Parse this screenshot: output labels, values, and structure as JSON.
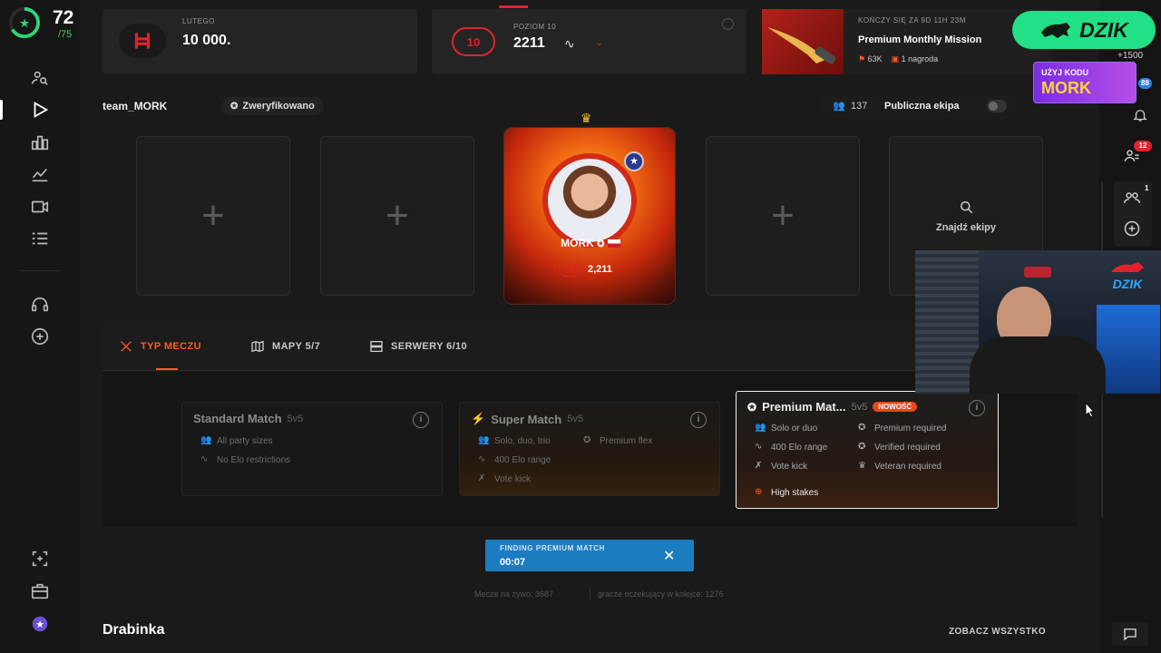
{
  "sidebar": {
    "level": "72",
    "level_sub": "/75"
  },
  "top_cards": {
    "points": {
      "label": "LUTEGO",
      "value": "10 000."
    },
    "level": {
      "label": "POZIOM 10",
      "badge": "10",
      "elo": "2211"
    },
    "mission": {
      "timer": "KOŃCZY SIĘ ZA 9D 11H 23M",
      "title": "Premium Monthly Mission",
      "stat1": "63K",
      "stat2": "1 nagroda"
    }
  },
  "sponsor": {
    "brand": "DZIK",
    "code_label": "UŻYJ KODU",
    "code": "MORK",
    "plus_text": "+1500"
  },
  "team": {
    "name": "team_MORK",
    "verified": "Zweryfikowano",
    "members": "137",
    "public_label": "Publiczna ekipa"
  },
  "player": {
    "name": "MORK",
    "level": "10",
    "elo": "2,211"
  },
  "find_team": {
    "label": "Znajdź ekipy"
  },
  "tabs": [
    {
      "label": "TYP MECZU"
    },
    {
      "label": "MAPY 5/7"
    },
    {
      "label": "SERWERY 6/10"
    }
  ],
  "matches": {
    "standard": {
      "title": "Standard Match",
      "format": "5v5",
      "features": [
        "All party sizes",
        "No Elo restrictions"
      ]
    },
    "super": {
      "title": "Super Match",
      "format": "5v5",
      "features": [
        "Solo, duo, trio",
        "400 Elo range",
        "Vote kick"
      ],
      "features_right": [
        "Premium flex"
      ]
    },
    "premium": {
      "title": "Premium Mat...",
      "format": "5v5",
      "new_badge": "NOWOŚĆ",
      "features": [
        "Solo or duo",
        "400 Elo range",
        "Vote kick"
      ],
      "features_right": [
        "Premium required",
        "Verified required",
        "Veteran required"
      ],
      "highlight": "High stakes"
    }
  },
  "finding": {
    "label": "FINDING PREMIUM MATCH",
    "time": "00:07"
  },
  "stats": {
    "live": "Mecze na żywo: 3687",
    "queue": "gracze oczekujący w kolejce: 1276"
  },
  "ladder": {
    "title": "Drabinka",
    "see_all": "ZOBACZ WSZYSTKO"
  },
  "notifications": {
    "friends_badge": "12",
    "party_badge": "1",
    "blue_badge": "88"
  },
  "colors": {
    "accent": "#ff5a1f",
    "brand_green": "#2fd27a",
    "finding_blue": "#1c7cc0"
  }
}
